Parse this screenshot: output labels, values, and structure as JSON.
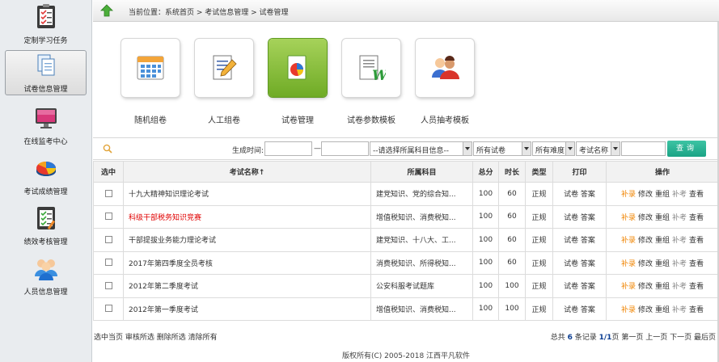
{
  "sidebar": {
    "items": [
      {
        "label": "定制学习任务",
        "icon": "task-board-icon"
      },
      {
        "label": "试卷信息管理",
        "icon": "documents-icon",
        "active": true
      },
      {
        "label": "在线监考中心",
        "icon": "monitor-icon"
      },
      {
        "label": "考试成绩管理",
        "icon": "pie-chart-icon"
      },
      {
        "label": "绩效考核管理",
        "icon": "checklist-icon"
      },
      {
        "label": "人员信息管理",
        "icon": "people-icon"
      }
    ]
  },
  "breadcrumb": {
    "text": "当前位置：系统首页 > 考试信息管理 > 试卷管理"
  },
  "tiles": [
    {
      "label": "随机组卷",
      "icon": "calendar-grid-icon"
    },
    {
      "label": "人工组卷",
      "icon": "pencil-paper-icon"
    },
    {
      "label": "试卷管理",
      "icon": "paper-chart-icon",
      "active": true
    },
    {
      "label": "试卷参数模板",
      "icon": "word-doc-icon"
    },
    {
      "label": "人员抽考模板",
      "icon": "users-icon"
    }
  ],
  "filters": {
    "gen_time_label": "生成时间:",
    "date_from": "",
    "date_to": "",
    "range_sep": "—",
    "subject_select": "--请选择所属科目信息--",
    "paper_select": "所有试卷",
    "difficulty_select": "所有难度",
    "field_select": "考试名称",
    "keyword": "",
    "search_label": "查询"
  },
  "table": {
    "headers": [
      "选中",
      "考试名称↑",
      "所属科目",
      "总分",
      "时长",
      "类型",
      "打印",
      "操作"
    ],
    "rows": [
      {
        "name": "十九大精神知识理论考试",
        "subject": "建党知识、党的综合知...",
        "total": "100",
        "duration": "60",
        "type": "正规",
        "print": "试卷 答案",
        "red": false
      },
      {
        "name": "科级干部税务知识竞赛",
        "subject": "增值税知识、消费税知...",
        "total": "100",
        "duration": "60",
        "type": "正规",
        "print": "试卷 答案",
        "red": true
      },
      {
        "name": "干部提拔业务能力理论考试",
        "subject": "建党知识、十八大、工...",
        "total": "100",
        "duration": "60",
        "type": "正规",
        "print": "试卷 答案",
        "red": false
      },
      {
        "name": "2017年第四季度全员考核",
        "subject": "消费税知识、所得税知...",
        "total": "100",
        "duration": "60",
        "type": "正规",
        "print": "试卷 答案",
        "red": false
      },
      {
        "name": "2012年第二季度考试",
        "subject": "公安科服考试题库",
        "total": "100",
        "duration": "100",
        "type": "正规",
        "print": "试卷 答案",
        "red": false
      },
      {
        "name": "2012年第一季度考试",
        "subject": "增值税知识、消费税知...",
        "total": "100",
        "duration": "100",
        "type": "正规",
        "print": "试卷 答案",
        "red": false
      }
    ],
    "ops": {
      "fill": "补录",
      "edit": "修改",
      "regroup": "重组",
      "retake": "补考",
      "view": "查看"
    }
  },
  "bulk_actions": "选中当页 审核所选 删除所选 清除所有",
  "pager": {
    "prefix": "总共",
    "total": "6",
    "records_suffix": "条记录",
    "page": "1/1",
    "page_suffix": "页",
    "first": "第一页",
    "prev": "上一页",
    "next": "下一页",
    "last": "最后页"
  },
  "copyright": "版权所有(C) 2005-2018 江西平凡软件",
  "colors": {
    "accent_green": "#1ba385",
    "tile_active": "#7ab72e",
    "op_orange": "#f08400",
    "red_name": "#e00000"
  }
}
